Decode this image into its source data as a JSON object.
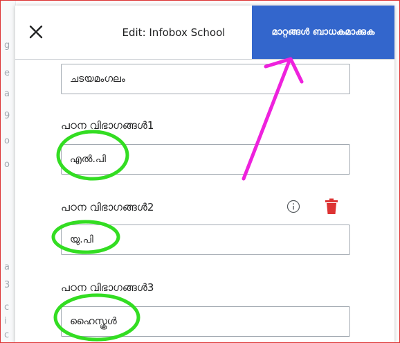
{
  "background_page": {
    "fragments": [
      "g",
      "e",
      "a",
      "9",
      "o",
      "o",
      "a",
      "3",
      "c",
      "i",
      "c"
    ]
  },
  "dialog": {
    "title": "Edit: Infobox School",
    "save_label": "മാറ്റങ്ങൾ ബാധകമാക്കുക"
  },
  "fields": [
    {
      "label": "",
      "value": "ചടയമംഗലം"
    },
    {
      "label": "പഠന വിഭാഗങ്ങൾ1",
      "value": "എൽ.പി"
    },
    {
      "label": "പഠന വിഭാഗങ്ങൾ2",
      "value": "യു.പി"
    },
    {
      "label": "പഠന വിഭാഗങ്ങൾ3",
      "value": "ഹൈസ്കൂൾ"
    }
  ],
  "colors": {
    "accent": "#3366cc",
    "annotation_circle": "#33dd22",
    "annotation_arrow": "#ee22dd",
    "delete": "#d33"
  },
  "icons": {
    "close": "close-icon",
    "info": "info-icon",
    "delete": "trash-icon"
  }
}
